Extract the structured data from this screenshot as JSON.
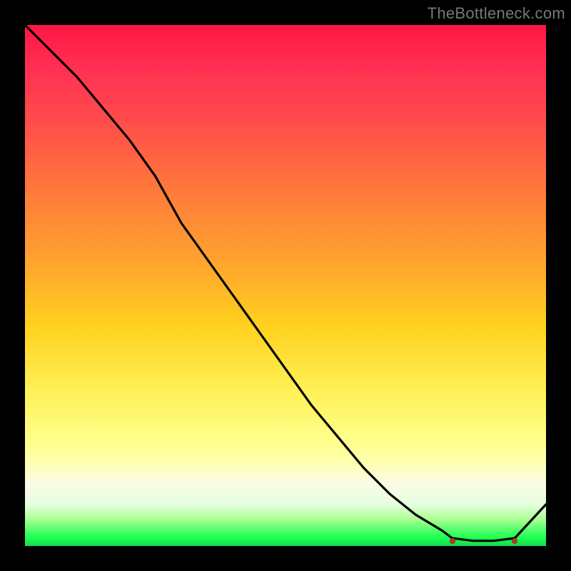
{
  "attribution": "TheBottleneck.com",
  "flat_label": "",
  "colors": {
    "line": "#000000",
    "label": "#b84a2a",
    "dot": "#af3a1f"
  },
  "chart_data": {
    "type": "line",
    "title": "",
    "xlabel": "",
    "ylabel": "",
    "xlim": [
      0,
      100
    ],
    "ylim": [
      0,
      100
    ],
    "series": [
      {
        "name": "bottleneck-curve",
        "x": [
          0,
          5,
          10,
          15,
          20,
          25,
          30,
          35,
          40,
          45,
          50,
          55,
          60,
          65,
          70,
          75,
          80,
          82,
          86,
          90,
          94,
          100
        ],
        "y": [
          100,
          95,
          90,
          84,
          78,
          71,
          62,
          55,
          48,
          41,
          34,
          27,
          21,
          15,
          10,
          6,
          3,
          1.5,
          1,
          1,
          1.5,
          8
        ]
      }
    ],
    "flat_region": {
      "x_start": 82,
      "x_end": 94,
      "y": 1
    },
    "gradient_meaning": "vertical heat gradient red→yellow→green (top = high bottleneck, bottom = low)"
  }
}
